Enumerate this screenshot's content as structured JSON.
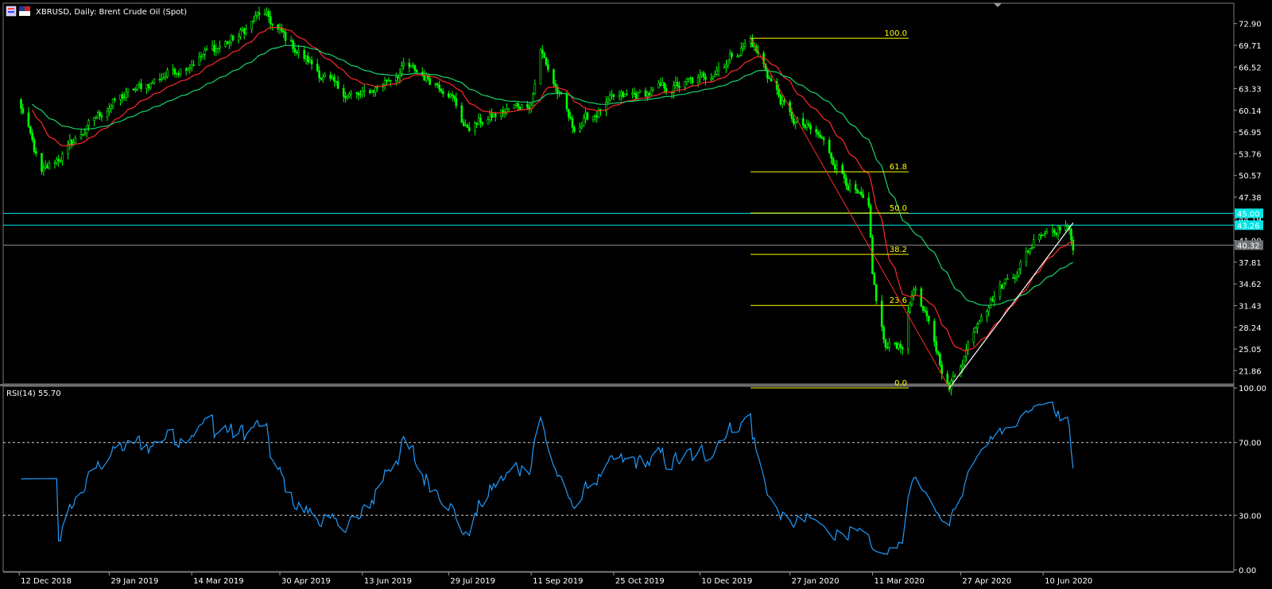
{
  "header": {
    "title": "XBRUSD, Daily:  Brent Crude Oil (Spot)"
  },
  "rsi": {
    "title": "RSI(14) 55.70",
    "ticks": [
      "100.00",
      "70.00",
      "30.00",
      "0.00"
    ]
  },
  "colors": {
    "background": "#000000",
    "bull_candle": "#00ff00",
    "ma_fast": "#ff2a2a",
    "ma_slow": "#19d26b",
    "fibonacci": "#ffff00",
    "resistance": "#00e5e5",
    "trendline": "#ffffff",
    "rsi_line": "#1e9bff"
  },
  "chart_data": [
    {
      "type": "candlestick",
      "title": "XBRUSD, Daily:  Brent Crude Oil (Spot)",
      "y_ticks": [
        "72.90",
        "69.71",
        "66.52",
        "63.33",
        "60.14",
        "56.95",
        "53.76",
        "50.57",
        "47.38",
        "44.19",
        "41.00",
        "37.81",
        "34.62",
        "31.43",
        "28.24",
        "25.05",
        "21.86"
      ],
      "ylim": [
        20.5,
        75.2
      ],
      "x_ticks": [
        "12 Dec 2018",
        "29 Jan 2019",
        "14 Mar 2019",
        "30 Apr 2019",
        "13 Jun 2019",
        "29 Jul 2019",
        "11 Sep 2019",
        "25 Oct 2019",
        "10 Dec 2019",
        "27 Jan 2020",
        "11 Mar 2020",
        "27 Apr 2020",
        "10 Jun 2020"
      ],
      "close_trend": [
        {
          "x": "12 Dec 2018",
          "y": 61.5
        },
        {
          "x": "24 Dec 2018",
          "y": 50.5
        },
        {
          "x": "29 Jan 2019",
          "y": 61.0
        },
        {
          "x": "14 Mar 2019",
          "y": 67.5
        },
        {
          "x": "08 Apr 2019",
          "y": 71.0
        },
        {
          "x": "20 Apr 2019",
          "y": 74.5
        },
        {
          "x": "30 Apr 2019",
          "y": 71.5
        },
        {
          "x": "31 May 2019",
          "y": 63.0
        },
        {
          "x": "13 Jun 2019",
          "y": 62.0
        },
        {
          "x": "05 Jul 2019",
          "y": 66.5
        },
        {
          "x": "29 Jul 2019",
          "y": 63.5
        },
        {
          "x": "07 Aug 2019",
          "y": 57.5
        },
        {
          "x": "11 Sep 2019",
          "y": 61.5
        },
        {
          "x": "16 Sep 2019",
          "y": 69.0
        },
        {
          "x": "03 Oct 2019",
          "y": 57.5
        },
        {
          "x": "25 Oct 2019",
          "y": 61.5
        },
        {
          "x": "10 Dec 2019",
          "y": 64.5
        },
        {
          "x": "06 Jan 2020",
          "y": 70.5
        },
        {
          "x": "27 Jan 2020",
          "y": 59.0
        },
        {
          "x": "12 Feb 2020",
          "y": 56.0
        },
        {
          "x": "09 Mar 2020",
          "y": 45.0
        },
        {
          "x": "11 Mar 2020",
          "y": 35.0
        },
        {
          "x": "18 Mar 2020",
          "y": 25.0
        },
        {
          "x": "27 Mar 2020",
          "y": 26.0
        },
        {
          "x": "02 Apr 2020",
          "y": 34.5
        },
        {
          "x": "21 Apr 2020",
          "y": 19.3
        },
        {
          "x": "27 Apr 2020",
          "y": 23.0
        },
        {
          "x": "08 May 2020",
          "y": 31.0
        },
        {
          "x": "29 May 2020",
          "y": 37.5
        },
        {
          "x": "08 Jun 2020",
          "y": 42.5
        },
        {
          "x": "22 Jun 2020",
          "y": 43.5
        },
        {
          "x": "26 Jun 2020",
          "y": 40.3
        }
      ],
      "moving_averages": [
        {
          "name": "",
          "color": "#ff2a2a"
        },
        {
          "name": "",
          "color": "#19d26b"
        }
      ],
      "fibonacci": {
        "from": {
          "x": "06 Jan 2020",
          "y": 70.75
        },
        "to": {
          "x": "21 Apr 2020",
          "y": 19.33
        },
        "levels": [
          {
            "label": "100.0",
            "value": 70.75
          },
          {
            "label": "61.8",
            "value": 51.11
          },
          {
            "label": "50.0",
            "value": 45.04
          },
          {
            "label": "38.2",
            "value": 38.97
          },
          {
            "label": "23.6",
            "value": 31.46
          },
          {
            "label": "0.0",
            "value": 19.33
          }
        ]
      },
      "horizontal_lines": [
        {
          "label": "45.00",
          "value": 45.0,
          "color": "#00e5e5"
        },
        {
          "label": "43.26",
          "value": 43.26,
          "color": "#00e5e5"
        }
      ],
      "current_price": {
        "label": "40.32",
        "value": 40.32
      },
      "trendline": {
        "from": {
          "x": "21 Apr 2020",
          "y": 19.3
        },
        "to": {
          "x": "26 Jun 2020",
          "y": 43.6
        }
      }
    },
    {
      "type": "line",
      "title": "RSI(14) 55.70",
      "ylim": [
        0,
        100
      ],
      "levels": [
        70,
        30
      ],
      "y_ticks": [
        "100.00",
        "70.00",
        "30.00",
        "0.00"
      ],
      "last_value": 55.7
    }
  ]
}
